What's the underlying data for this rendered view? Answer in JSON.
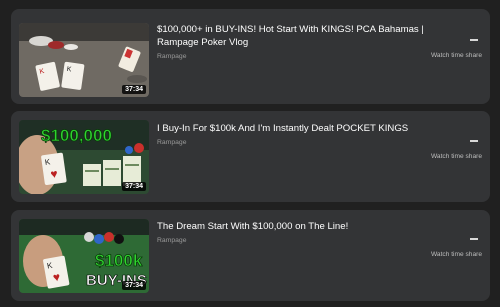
{
  "videos": [
    {
      "title": "$100,000+ in BUY-INS! Hot Start With KINGS! PCA Bahamas | Rampage Poker Vlog",
      "channel": "Rampage",
      "duration": "37:34",
      "action_label": "Watch time share"
    },
    {
      "title": "I Buy-In For $100k And I'm Instantly Dealt POCKET KINGS",
      "channel": "Rampage",
      "duration": "37:34",
      "action_label": "Watch time share",
      "thumbnail_text": "$100,000"
    },
    {
      "title": "The Dream Start With $100,000 on The Line!",
      "channel": "Rampage",
      "duration": "37:34",
      "action_label": "Watch time share",
      "thumbnail_text": [
        "$100k",
        "BUY-INS"
      ]
    }
  ],
  "colors": {
    "background": "#202020",
    "card": "#333436",
    "accent_green": "#2fd52f"
  }
}
